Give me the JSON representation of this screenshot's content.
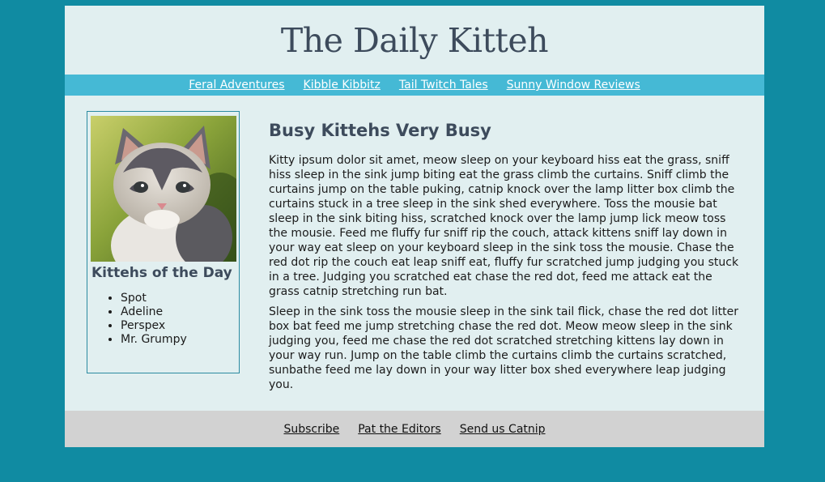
{
  "masthead": {
    "title": "The Daily Kitteh"
  },
  "nav": {
    "items": [
      "Feral Adventures",
      "Kibble Kibbitz",
      "Tail Twitch Tales",
      "Sunny Window Reviews"
    ]
  },
  "sidebar": {
    "heading": "Kittehs of the Day",
    "kittehs": [
      "Spot",
      "Adeline",
      "Perspex",
      "Mr. Grumpy"
    ]
  },
  "article": {
    "heading": "Busy Kittehs Very Busy",
    "paragraphs": [
      "Kitty ipsum dolor sit amet, meow sleep on your keyboard hiss eat the grass, sniff hiss sleep in the sink jump biting eat the grass climb the curtains. Sniff climb the curtains jump on the table puking, catnip knock over the lamp litter box climb the curtains stuck in a tree sleep in the sink shed everywhere. Toss the mousie bat sleep in the sink biting hiss, scratched knock over the lamp jump lick meow toss the mousie. Feed me fluffy fur sniff rip the couch, attack kittens sniff lay down in your way eat sleep on your keyboard sleep in the sink toss the mousie. Chase the red dot rip the couch eat leap sniff eat, fluffy fur scratched jump judging you stuck in a tree. Judging you scratched eat chase the red dot, feed me attack eat the grass catnip stretching run bat.",
      "Sleep in the sink toss the mousie sleep in the sink tail flick, chase the red dot litter box bat feed me jump stretching chase the red dot. Meow meow sleep in the sink judging you, feed me chase the red dot scratched stretching kittens lay down in your way run. Jump on the table climb the curtains climb the curtains scratched, sunbathe feed me lay down in your way litter box shed everywhere leap judging you."
    ]
  },
  "footer": {
    "links": [
      "Subscribe",
      "Pat the Editors",
      "Send us Catnip"
    ]
  }
}
